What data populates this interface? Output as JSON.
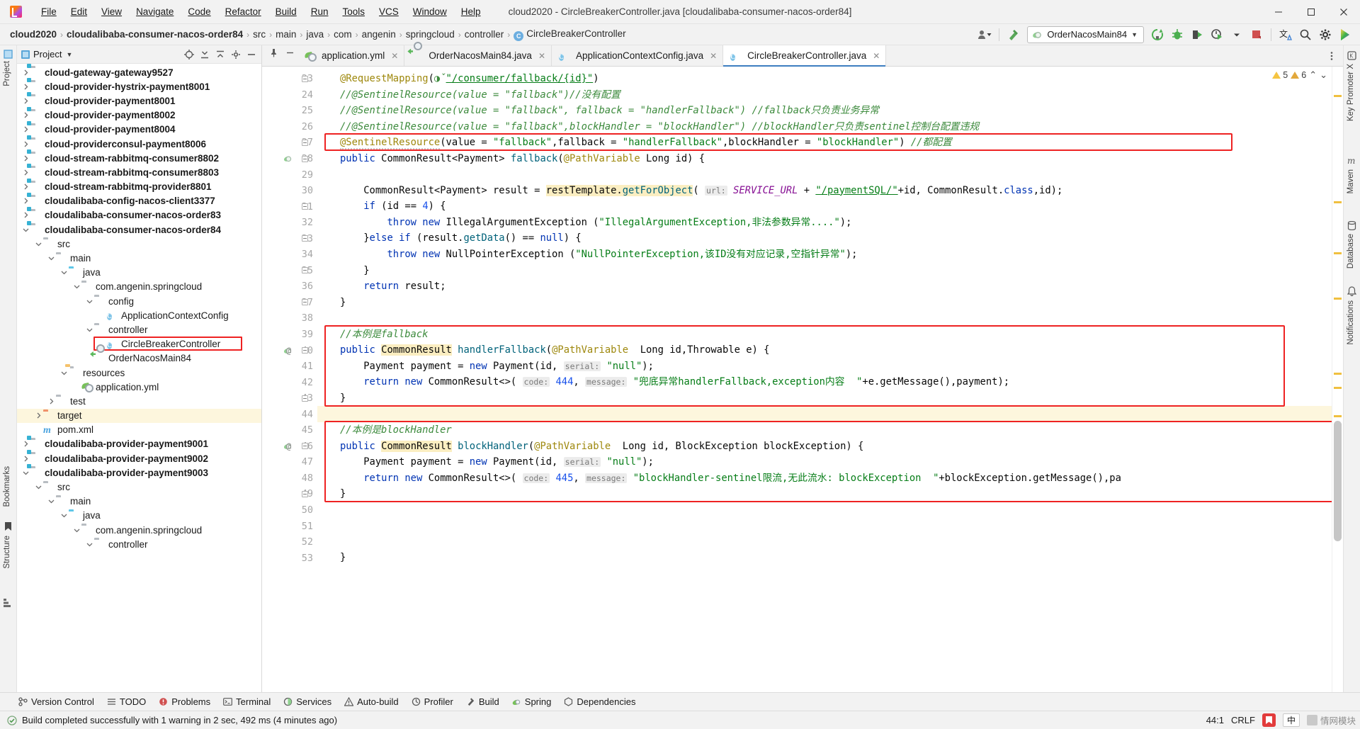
{
  "window": {
    "title": "cloud2020 - CircleBreakerController.java [cloudalibaba-consumer-nacos-order84]",
    "minimize": "—",
    "maximize": "❐",
    "close": "✕"
  },
  "menubar": {
    "items": [
      "File",
      "Edit",
      "View",
      "Navigate",
      "Code",
      "Refactor",
      "Build",
      "Run",
      "Tools",
      "VCS",
      "Window",
      "Help"
    ]
  },
  "breadcrumb": {
    "items": [
      {
        "label": "cloud2020",
        "bold": true,
        "icon": ""
      },
      {
        "label": "cloudalibaba-consumer-nacos-order84",
        "bold": true,
        "icon": ""
      },
      {
        "label": "src",
        "bold": false,
        "icon": ""
      },
      {
        "label": "main",
        "bold": false,
        "icon": ""
      },
      {
        "label": "java",
        "bold": false,
        "icon": ""
      },
      {
        "label": "com",
        "bold": false,
        "icon": ""
      },
      {
        "label": "angenin",
        "bold": false,
        "icon": ""
      },
      {
        "label": "springcloud",
        "bold": false,
        "icon": ""
      },
      {
        "label": "controller",
        "bold": false,
        "icon": ""
      },
      {
        "label": "CircleBreakerController",
        "bold": false,
        "icon": "java-class-icon"
      }
    ],
    "separator": "›"
  },
  "toolbar": {
    "run_config_name": "OrderNacosMain84",
    "dropdown_caret": "▼",
    "icons": [
      "user-dropdown-icon",
      "hammer-build-icon",
      "rerun-icon",
      "debug-icon",
      "run-with-coverage-icon",
      "profiler-icon",
      "more-run-icon",
      "stop-icon",
      "translate-icon",
      "search-everywhere-icon",
      "settings-gear-icon",
      "ide-assistant-icon"
    ]
  },
  "project_panel": {
    "title": "Project",
    "title_caret": "▼",
    "tool_icons": [
      "scope-target-icon",
      "expand-all-icon",
      "collapse-all-icon",
      "settings-icon",
      "hide-icon"
    ],
    "tree": [
      {
        "depth": 1,
        "arrow": "right",
        "icon": "module-icon",
        "label": "cloud-gateway-gateway9527",
        "bold": true
      },
      {
        "depth": 1,
        "arrow": "right",
        "icon": "module-icon",
        "label": "cloud-provider-hystrix-payment8001",
        "bold": true
      },
      {
        "depth": 1,
        "arrow": "right",
        "icon": "module-icon",
        "label": "cloud-provider-payment8001",
        "bold": true
      },
      {
        "depth": 1,
        "arrow": "right",
        "icon": "module-icon",
        "label": "cloud-provider-payment8002",
        "bold": true
      },
      {
        "depth": 1,
        "arrow": "right",
        "icon": "module-icon",
        "label": "cloud-provider-payment8004",
        "bold": true
      },
      {
        "depth": 1,
        "arrow": "right",
        "icon": "module-icon",
        "label": "cloud-providerconsul-payment8006",
        "bold": true
      },
      {
        "depth": 1,
        "arrow": "right",
        "icon": "module-icon",
        "label": "cloud-stream-rabbitmq-consumer8802",
        "bold": true
      },
      {
        "depth": 1,
        "arrow": "right",
        "icon": "module-icon",
        "label": "cloud-stream-rabbitmq-consumer8803",
        "bold": true
      },
      {
        "depth": 1,
        "arrow": "right",
        "icon": "module-icon",
        "label": "cloud-stream-rabbitmq-provider8801",
        "bold": true
      },
      {
        "depth": 1,
        "arrow": "right",
        "icon": "module-icon",
        "label": "cloudalibaba-config-nacos-client3377",
        "bold": true
      },
      {
        "depth": 1,
        "arrow": "right",
        "icon": "module-icon",
        "label": "cloudalibaba-consumer-nacos-order83",
        "bold": true
      },
      {
        "depth": 1,
        "arrow": "down",
        "icon": "module-icon",
        "label": "cloudalibaba-consumer-nacos-order84",
        "bold": true
      },
      {
        "depth": 2,
        "arrow": "down",
        "icon": "folder-icon",
        "label": "src",
        "bold": false
      },
      {
        "depth": 3,
        "arrow": "down",
        "icon": "folder-icon",
        "label": "main",
        "bold": false
      },
      {
        "depth": 4,
        "arrow": "down",
        "icon": "source-root-icon",
        "label": "java",
        "bold": false
      },
      {
        "depth": 5,
        "arrow": "down",
        "icon": "package-icon",
        "label": "com.angenin.springcloud",
        "bold": false
      },
      {
        "depth": 6,
        "arrow": "down",
        "icon": "package-icon",
        "label": "config",
        "bold": false
      },
      {
        "depth": 7,
        "arrow": "none",
        "icon": "java-class-icon",
        "label": "ApplicationContextConfig",
        "bold": false
      },
      {
        "depth": 6,
        "arrow": "down",
        "icon": "package-icon",
        "label": "controller",
        "bold": false
      },
      {
        "depth": 7,
        "arrow": "none",
        "icon": "java-class-icon",
        "label": "CircleBreakerController",
        "bold": false,
        "highlight_box": true
      },
      {
        "depth": 6,
        "arrow": "none",
        "icon": "spring-boot-class-icon",
        "label": "OrderNacosMain84",
        "bold": false
      },
      {
        "depth": 4,
        "arrow": "down",
        "icon": "resources-folder-icon",
        "label": "resources",
        "bold": false
      },
      {
        "depth": 5,
        "arrow": "none",
        "icon": "yaml-spring-icon",
        "label": "application.yml",
        "bold": false
      },
      {
        "depth": 3,
        "arrow": "right",
        "icon": "folder-icon",
        "label": "test",
        "bold": false
      },
      {
        "depth": 2,
        "arrow": "right",
        "icon": "target-folder-icon",
        "label": "target",
        "bold": false,
        "row_highlight": true
      },
      {
        "depth": 2,
        "arrow": "none",
        "icon": "maven-pom-icon",
        "label": "pom.xml",
        "bold": false
      },
      {
        "depth": 1,
        "arrow": "right",
        "icon": "module-icon",
        "label": "cloudalibaba-provider-payment9001",
        "bold": true
      },
      {
        "depth": 1,
        "arrow": "right",
        "icon": "module-icon",
        "label": "cloudalibaba-provider-payment9002",
        "bold": true
      },
      {
        "depth": 1,
        "arrow": "down",
        "icon": "module-icon",
        "label": "cloudalibaba-provider-payment9003",
        "bold": true
      },
      {
        "depth": 2,
        "arrow": "down",
        "icon": "folder-icon",
        "label": "src",
        "bold": false
      },
      {
        "depth": 3,
        "arrow": "down",
        "icon": "folder-icon",
        "label": "main",
        "bold": false
      },
      {
        "depth": 4,
        "arrow": "down",
        "icon": "source-root-icon",
        "label": "java",
        "bold": false
      },
      {
        "depth": 5,
        "arrow": "down",
        "icon": "package-icon",
        "label": "com.angenin.springcloud",
        "bold": false
      },
      {
        "depth": 6,
        "arrow": "down",
        "icon": "package-icon",
        "label": "controller",
        "bold": false
      }
    ]
  },
  "left_rail": {
    "label": "Project",
    "bookmarks": "Bookmarks",
    "structure": "Structure"
  },
  "right_rail": {
    "items": [
      "Key Promoter X",
      "Maven",
      "Database",
      "Notifications"
    ]
  },
  "editor_tabs": [
    {
      "label": "application.yml",
      "icon": "yaml-spring-icon",
      "active": false,
      "close": "✕"
    },
    {
      "label": "OrderNacosMain84.java",
      "icon": "spring-boot-class-icon",
      "active": false,
      "close": "✕"
    },
    {
      "label": "ApplicationContextConfig.java",
      "icon": "java-class-icon",
      "active": false,
      "close": "✕"
    },
    {
      "label": "CircleBreakerController.java",
      "icon": "java-class-icon",
      "active": true,
      "close": "✕"
    }
  ],
  "inspections": {
    "warnings": "5",
    "weak_warnings": "6",
    "caret_up": "⌃",
    "caret_down": "⌄"
  },
  "code": {
    "first_line_number": 23,
    "lines": [
      {
        "n": 23,
        "html": "<span class=\"an\">@RequestMapping</span>(<span class=\"gl\">◑ˇ</span><span class=\"s ul\">\"/consumer/fallback/{id}\"</span>)"
      },
      {
        "n": 24,
        "html": "<span class=\"cmg\">//@SentinelResource(value = \"fallback\")//没有配置</span>"
      },
      {
        "n": 25,
        "html": "<span class=\"cmg\">//@SentinelResource(value = \"fallback\", fallback = \"handlerFallback\") //fallback只负责业务异常</span>"
      },
      {
        "n": 26,
        "html": "<span class=\"cmg\">//@SentinelResource(value = \"fallback\",blockHandler = \"blockHandler\") //blockHandler只负责sentinel控制台配置违规</span>"
      },
      {
        "n": 27,
        "html": "<span class=\"an squig\">@SentinelResource</span>(<span class=\"id\">value</span> = <span class=\"s\">\"fallback\"</span>,<span class=\"id\">fallback</span> = <span class=\"s\">\"handlerFallback\"</span>,<span class=\"id\">blockHandler</span> = <span class=\"s\">\"blockHandler\"</span>) <span class=\"cmg\">//都配置</span>"
      },
      {
        "n": 28,
        "html": "<span class=\"k\">public</span> CommonResult&lt;Payment&gt; <span class=\"fn\">fallback</span>(<span class=\"an\">@PathVariable</span> <span class=\"ty\">Long</span> id) {"
      },
      {
        "n": 29,
        "html": ""
      },
      {
        "n": 30,
        "html": "    CommonResult&lt;Payment&gt; result = <span class=\"hlg\">restTemplate.<span class=\"fn\">getForObject</span></span>( <span class=\"par\">url:</span> <span class=\"st\">SERVICE_URL</span> + <span class=\"s ul\">\"/paymentSQL/\"</span>+id, CommonResult.<span class=\"k\">class</span>,id);"
      },
      {
        "n": 31,
        "html": "    <span class=\"k\">if</span> (id == <span class=\"n\">4</span>) {"
      },
      {
        "n": 32,
        "html": "        <span class=\"k\">throw new</span> IllegalArgumentException (<span class=\"s\">\"IllegalArgumentException,非法参数异常....\"</span>);"
      },
      {
        "n": 33,
        "html": "    }<span class=\"k\">else if</span> (result.<span class=\"fn\">getData</span>() == <span class=\"k\">null</span>) {"
      },
      {
        "n": 34,
        "html": "        <span class=\"k\">throw new</span> NullPointerException (<span class=\"s\">\"NullPointerException,该ID没有对应记录,空指针异常\"</span>);"
      },
      {
        "n": 35,
        "html": "    }"
      },
      {
        "n": 36,
        "html": "    <span class=\"k\">return</span> result;"
      },
      {
        "n": 37,
        "html": "}"
      },
      {
        "n": 38,
        "html": ""
      },
      {
        "n": 39,
        "html": "<span class=\"cmg\">//本例是fallback</span>"
      },
      {
        "n": 40,
        "html": "<span class=\"k\">public</span> <span class=\"hlg\">CommonResult</span> <span class=\"fn\">handlerFallback</span>(<span class=\"an\">@PathVariable</span>  <span class=\"ty\">Long</span> id,Throwable e) {"
      },
      {
        "n": 41,
        "html": "    Payment payment = <span class=\"k\">new</span> Payment(id, <span class=\"par\">serial:</span> <span class=\"s\">\"null\"</span>);"
      },
      {
        "n": 42,
        "html": "    <span class=\"k\">return new</span> CommonResult&lt;&gt;( <span class=\"par\">code:</span> <span class=\"n\">444</span>, <span class=\"par\">message:</span> <span class=\"s\">\"兜底异常handlerFallback,exception内容  \"</span>+e.getMessage(),payment);"
      },
      {
        "n": 43,
        "html": "}"
      },
      {
        "n": 44,
        "html": "",
        "row_highlight": true
      },
      {
        "n": 45,
        "html": "<span class=\"cmg\">//本例是blockHandler</span>"
      },
      {
        "n": 46,
        "html": "<span class=\"k\">public</span> <span class=\"hlg\">CommonResult</span> <span class=\"fn\">blockHandler</span>(<span class=\"an\">@PathVariable</span>  <span class=\"ty\">Long</span> id, BlockException blockException) {"
      },
      {
        "n": 47,
        "html": "    Payment payment = <span class=\"k\">new</span> Payment(id, <span class=\"par\">serial:</span> <span class=\"s\">\"null\"</span>);"
      },
      {
        "n": 48,
        "html": "    <span class=\"k\">return new</span> CommonResult&lt;&gt;( <span class=\"par\">code:</span> <span class=\"n\">445</span>, <span class=\"par\">message:</span> <span class=\"s\">\"blockHandler-sentinel限流,无此流水: blockException  \"</span>+blockException.getMessage(),pa"
      },
      {
        "n": 49,
        "html": "}"
      },
      {
        "n": 50,
        "html": ""
      },
      {
        "n": 51,
        "html": ""
      },
      {
        "n": 52,
        "html": ""
      },
      {
        "n": 53,
        "html": "}"
      }
    ]
  },
  "tool_window_bar": {
    "items": [
      {
        "label": "Version Control",
        "icon": "branch-icon"
      },
      {
        "label": "TODO",
        "icon": "list-icon"
      },
      {
        "label": "Problems",
        "icon": "error-circle-icon"
      },
      {
        "label": "Terminal",
        "icon": "terminal-icon"
      },
      {
        "label": "Services",
        "icon": "services-icon"
      },
      {
        "label": "Auto-build",
        "icon": "warning-triangle-icon"
      },
      {
        "label": "Profiler",
        "icon": "profiler-icon"
      },
      {
        "label": "Build",
        "icon": "hammer-icon"
      },
      {
        "label": "Spring",
        "icon": "spring-leaf-icon"
      },
      {
        "label": "Dependencies",
        "icon": "dependencies-icon"
      }
    ]
  },
  "statusbar": {
    "message": "Build completed successfully with 1 warning in 2 sec, 492 ms (4 minutes ago)",
    "message_icon": "checkmark-icon",
    "caret_position": "44:1",
    "line_separator": "CRLF",
    "ime_label": "中",
    "watermark": "情网模块"
  }
}
